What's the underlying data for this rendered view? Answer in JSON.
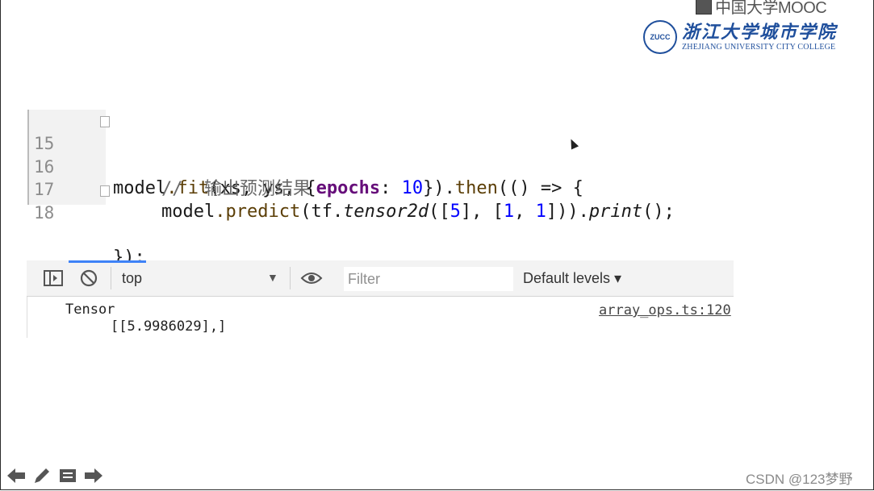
{
  "branding": {
    "mooc_text": "中国大学MOOC",
    "college_seal": "ZUCC",
    "college_name_cn": "浙江大学城市学院",
    "college_name_en": "ZHEJIANG UNIVERSITY CITY COLLEGE"
  },
  "code": {
    "lines": [
      {
        "num": "15"
      },
      {
        "num": "16",
        "comment": "//  输出预测结果"
      },
      {
        "num": "17"
      },
      {
        "num": "18",
        "text": "});"
      }
    ],
    "tokens": {
      "model": "model",
      "fit": ".fit",
      "args_a": "(xs, ys, {",
      "epochs": "epochs",
      "colon": ": ",
      "ten": "10",
      "then_open": "}).",
      "then": "then",
      "arrow": "(() => {",
      "predict": ".predict",
      "tf_open": "(tf.",
      "tensor2d": "tensor2d",
      "open_bracket": "([",
      "five": "5",
      "mid": "], [",
      "one_a": "1",
      "comma": ", ",
      "one_b": "1",
      "close": "])).",
      "print": "print",
      "end": "();"
    }
  },
  "console": {
    "context": "top",
    "filter_placeholder": "Filter",
    "levels": "Default levels ▾",
    "output_line1": "Tensor",
    "output_line2": "[[5.9986029],]",
    "source_link": "array_ops.ts:120"
  },
  "watermark": "CSDN @123梦野"
}
